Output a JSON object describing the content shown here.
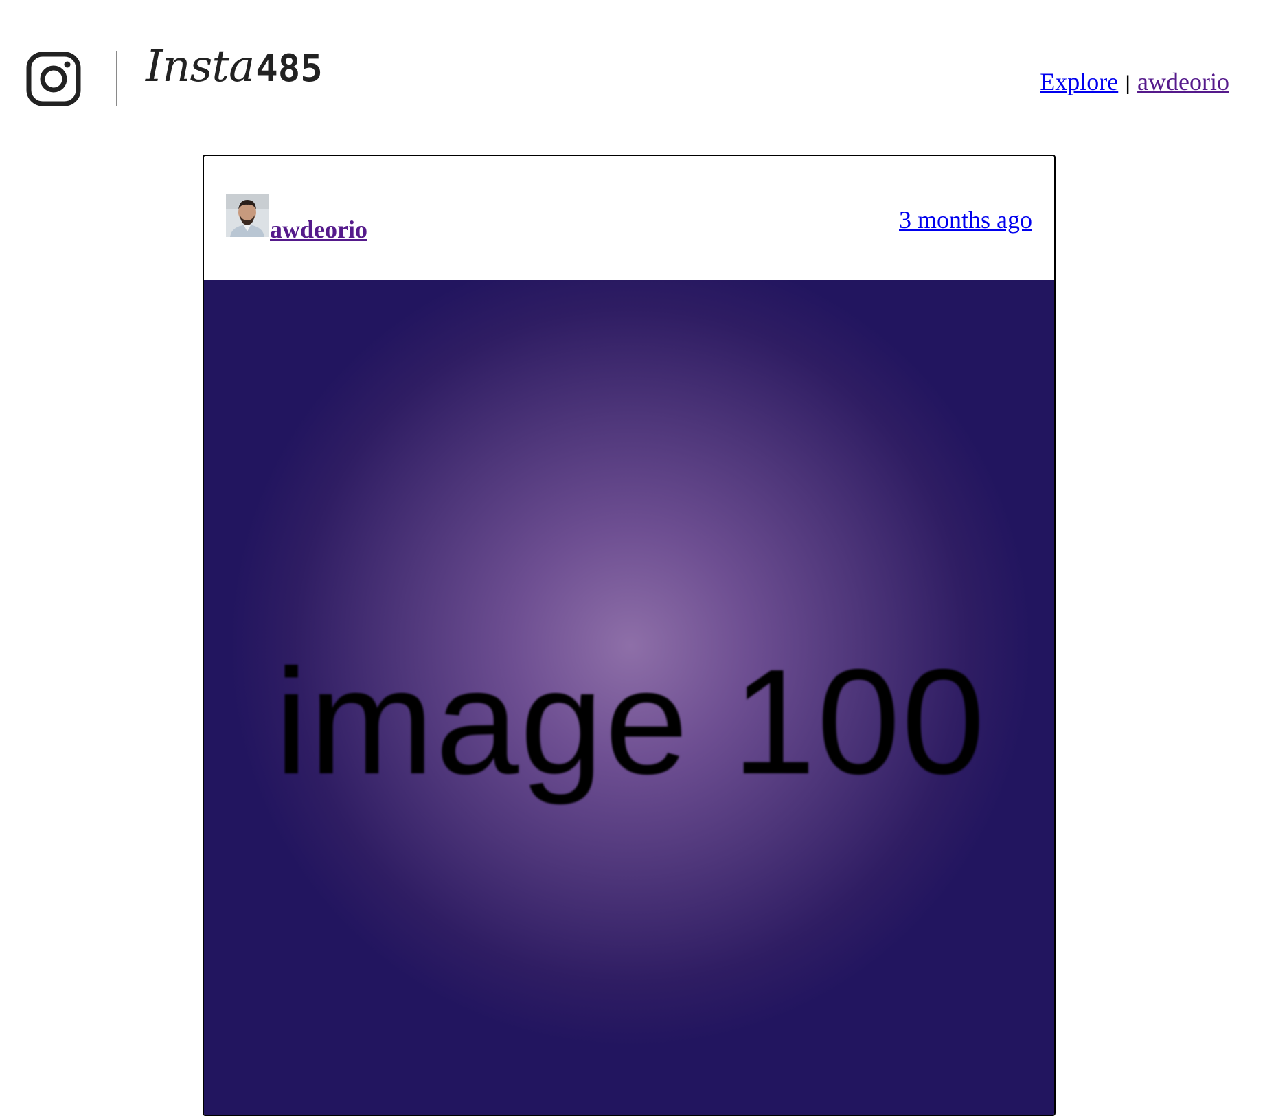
{
  "header": {
    "logo_icon": "instagram-camera-icon",
    "logo_script": "Insta",
    "logo_number": "485",
    "nav": {
      "explore_label": "Explore",
      "separator": "|",
      "user_label": "awdeorio"
    }
  },
  "post": {
    "avatar_icon": "user-avatar-photo",
    "owner": "awdeorio",
    "timestamp": "3 months ago",
    "image_text": "image 100",
    "image_colors": {
      "center": "#8e6fa8",
      "edge": "#22155f"
    }
  },
  "colors": {
    "link": "#0000ee",
    "visited_link": "#551a8b"
  }
}
